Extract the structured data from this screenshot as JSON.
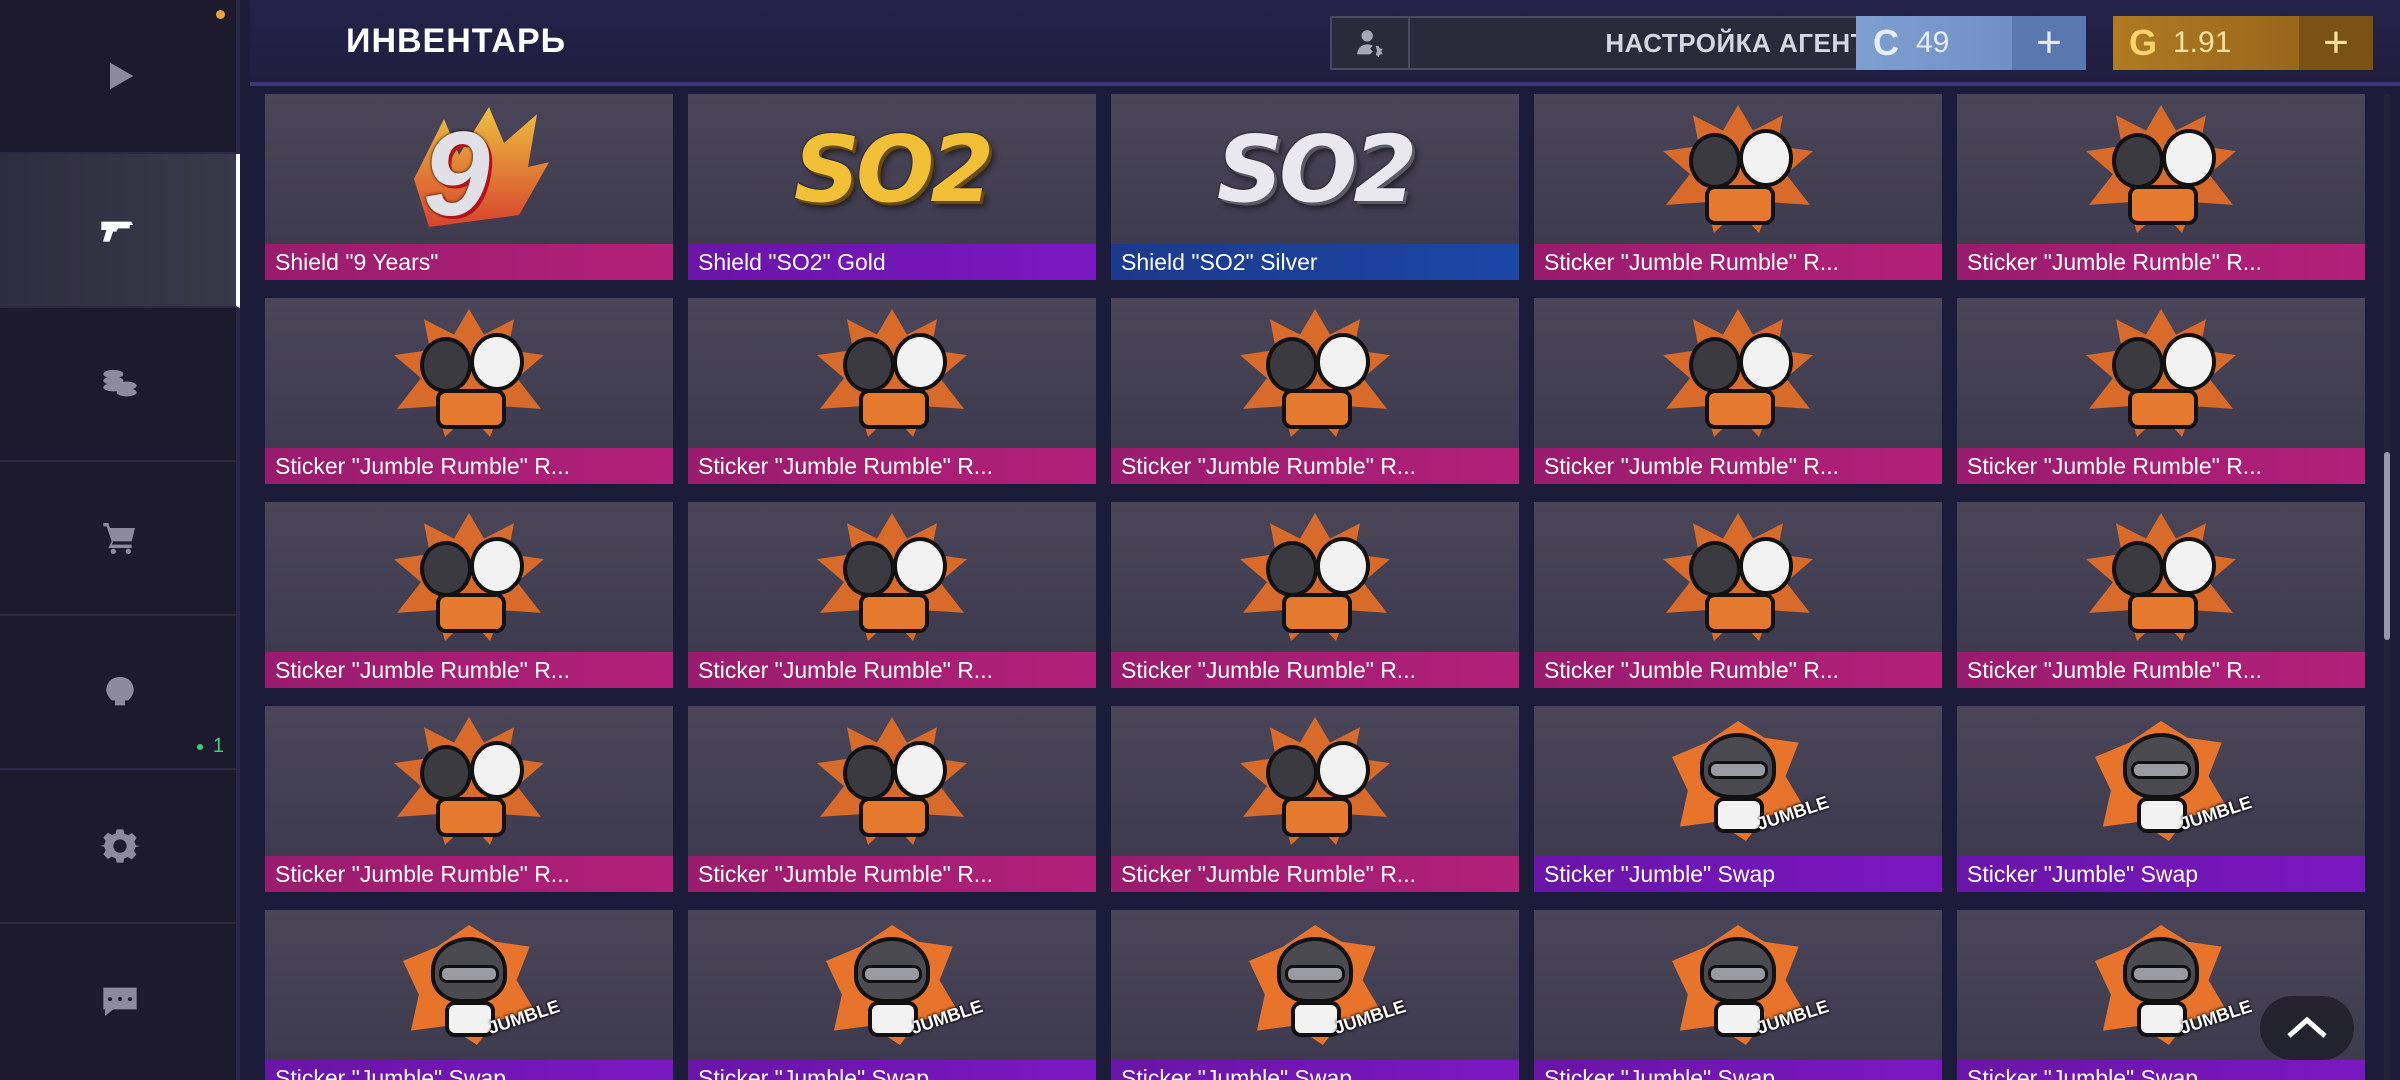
{
  "header": {
    "title": "ИНВЕНТАРЬ",
    "agent_button_label": "НАСТРОЙКА АГЕНТА",
    "silver_currency": {
      "symbol": "C",
      "value": "49",
      "add": "+"
    },
    "gold_currency": {
      "symbol": "G",
      "value": "1.91",
      "add": "+"
    }
  },
  "sidebar": {
    "items": [
      {
        "name": "play",
        "icon": "play-icon"
      },
      {
        "name": "inventory",
        "icon": "pistol-icon",
        "active": true
      },
      {
        "name": "market",
        "icon": "coins-icon"
      },
      {
        "name": "shop",
        "icon": "cart-icon"
      },
      {
        "name": "clan",
        "icon": "shield-crest-icon",
        "badge": "1"
      },
      {
        "name": "settings",
        "icon": "gear-icon"
      },
      {
        "name": "chat",
        "icon": "chat-icon"
      }
    ]
  },
  "colors": {
    "rarity_pink": "#b2207a",
    "rarity_purple": "#7a18c0",
    "rarity_blue": "#1c46a6",
    "silver": "#7f9fd2",
    "gold": "#b07a22"
  },
  "items": [
    {
      "name": "Shield \"9 Years\"",
      "rarity": "pink",
      "art": "nine"
    },
    {
      "name": "Shield \"SO2\" Gold",
      "rarity": "purple",
      "art": "so2-gold"
    },
    {
      "name": "Shield \"SO2\" Silver",
      "rarity": "blue",
      "art": "so2-silver"
    },
    {
      "name": "Sticker \"Jumble Rumble\" R...",
      "rarity": "pink",
      "art": "rumble"
    },
    {
      "name": "Sticker \"Jumble Rumble\" R...",
      "rarity": "pink",
      "art": "rumble"
    },
    {
      "name": "Sticker \"Jumble Rumble\" R...",
      "rarity": "pink",
      "art": "rumble"
    },
    {
      "name": "Sticker \"Jumble Rumble\" R...",
      "rarity": "pink",
      "art": "rumble"
    },
    {
      "name": "Sticker \"Jumble Rumble\" R...",
      "rarity": "pink",
      "art": "rumble"
    },
    {
      "name": "Sticker \"Jumble Rumble\" R...",
      "rarity": "pink",
      "art": "rumble"
    },
    {
      "name": "Sticker \"Jumble Rumble\" R...",
      "rarity": "pink",
      "art": "rumble"
    },
    {
      "name": "Sticker \"Jumble Rumble\" R...",
      "rarity": "pink",
      "art": "rumble"
    },
    {
      "name": "Sticker \"Jumble Rumble\" R...",
      "rarity": "pink",
      "art": "rumble"
    },
    {
      "name": "Sticker \"Jumble Rumble\" R...",
      "rarity": "pink",
      "art": "rumble"
    },
    {
      "name": "Sticker \"Jumble Rumble\" R...",
      "rarity": "pink",
      "art": "rumble"
    },
    {
      "name": "Sticker \"Jumble Rumble\" R...",
      "rarity": "pink",
      "art": "rumble"
    },
    {
      "name": "Sticker \"Jumble Rumble\" R...",
      "rarity": "pink",
      "art": "rumble"
    },
    {
      "name": "Sticker \"Jumble Rumble\" R...",
      "rarity": "pink",
      "art": "rumble"
    },
    {
      "name": "Sticker \"Jumble Rumble\" R...",
      "rarity": "pink",
      "art": "rumble"
    },
    {
      "name": "Sticker \"Jumble\" Swap",
      "rarity": "purple",
      "art": "swap"
    },
    {
      "name": "Sticker \"Jumble\" Swap",
      "rarity": "purple",
      "art": "swap"
    },
    {
      "name": "Sticker \"Jumble\" Swap",
      "rarity": "purple",
      "art": "swap"
    },
    {
      "name": "Sticker \"Jumble\" Swap",
      "rarity": "purple",
      "art": "swap"
    },
    {
      "name": "Sticker \"Jumble\" Swap",
      "rarity": "purple",
      "art": "swap"
    },
    {
      "name": "Sticker \"Jumble\" Swap",
      "rarity": "purple",
      "art": "swap"
    },
    {
      "name": "Sticker \"Jumble\" Swap",
      "rarity": "purple",
      "art": "swap"
    }
  ],
  "swap_art_text": "JUMBLE"
}
